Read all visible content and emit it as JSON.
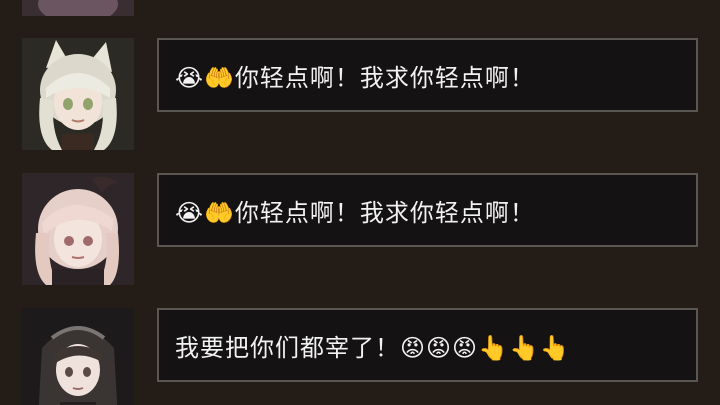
{
  "messages": [
    {
      "avatar_icon": "white-haired-cat-ear-girl-avatar-icon",
      "text": "😭🤲你轻点啊！我求你轻点啊！"
    },
    {
      "avatar_icon": "pink-haired-horned-girl-avatar-icon",
      "text": "😭🤲你轻点啊！我求你轻点啊！"
    },
    {
      "avatar_icon": "dark-haired-veiled-girl-avatar-icon",
      "text": "我要把你们都宰了！😡😡😡👆👆👆"
    }
  ],
  "colors": {
    "background": "#241c17",
    "bubble_fill": "#141212",
    "bubble_border": "#5a5652",
    "text": "#f2f2f2"
  }
}
